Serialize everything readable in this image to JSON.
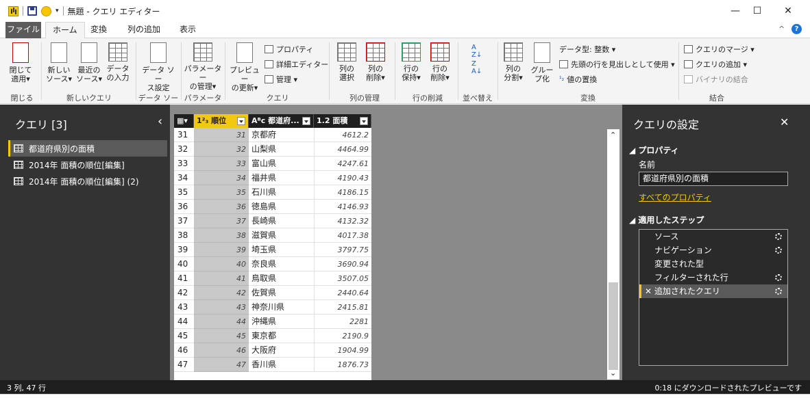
{
  "window": {
    "title": "無題 - クエリ エディター",
    "minimize": "—",
    "maximize": "☐",
    "close": "✕"
  },
  "tabs": [
    "ファイル",
    "ホーム",
    "変換",
    "列の追加",
    "表示"
  ],
  "ribbon": {
    "close_group": {
      "btn": "閉じて\n適用▾",
      "label": "閉じる"
    },
    "new_query": {
      "new_source": "新しい\nソース▾",
      "recent_source": "最近の\nソース▾",
      "enter_data": "データ\nの入力",
      "label": "新しいクエリ"
    },
    "data_source": {
      "btn": "データ ソー\nス設定",
      "label": "データ ソース"
    },
    "params": {
      "btn": "パラメーター\nの管理▾",
      "label": "パラメーター"
    },
    "query": {
      "preview": "プレビュー\nの更新▾",
      "properties": "プロパティ",
      "advanced": "詳細エディター",
      "manage": "管理 ▾",
      "label": "クエリ"
    },
    "columns": {
      "select": "列の\n選択",
      "remove": "列の\n削除▾",
      "label": "列の管理"
    },
    "rows": {
      "keep": "行の\n保持▾",
      "remove": "行の\n削除▾",
      "label": "行の削減"
    },
    "sort": {
      "label": "並べ替え"
    },
    "transform": {
      "split": "列の\n分割▾",
      "group": "グルー\nプ化",
      "datatype": "データ型: 整数 ▾",
      "header": "先頭の行を見出しとして使用 ▾",
      "replace": "値の置換",
      "label": "変換"
    },
    "combine": {
      "merge": "クエリのマージ ▾",
      "append": "クエリの追加 ▾",
      "binary": "バイナリの結合",
      "label": "結合"
    }
  },
  "left_panel": {
    "title": "クエリ [3]",
    "collapse": "‹",
    "queries": [
      "都道府県別の面積",
      "2014年 面積の順位[編集]",
      "2014年 面積の順位[編集] (2)"
    ]
  },
  "grid": {
    "headers": [
      "1²₃ 順位",
      "Aᴮc 都道府...",
      "1.2 面積"
    ],
    "rows": [
      [
        "31",
        "31",
        "京都府",
        "4612.2"
      ],
      [
        "32",
        "32",
        "山梨県",
        "4464.99"
      ],
      [
        "33",
        "33",
        "富山県",
        "4247.61"
      ],
      [
        "34",
        "34",
        "福井県",
        "4190.43"
      ],
      [
        "35",
        "35",
        "石川県",
        "4186.15"
      ],
      [
        "36",
        "36",
        "徳島県",
        "4146.93"
      ],
      [
        "37",
        "37",
        "長崎県",
        "4132.32"
      ],
      [
        "38",
        "38",
        "滋賀県",
        "4017.38"
      ],
      [
        "39",
        "39",
        "埼玉県",
        "3797.75"
      ],
      [
        "40",
        "40",
        "奈良県",
        "3690.94"
      ],
      [
        "41",
        "41",
        "鳥取県",
        "3507.05"
      ],
      [
        "42",
        "42",
        "佐賀県",
        "2440.64"
      ],
      [
        "43",
        "43",
        "神奈川県",
        "2415.81"
      ],
      [
        "44",
        "44",
        "沖縄県",
        "2281"
      ],
      [
        "45",
        "45",
        "東京都",
        "2190.9"
      ],
      [
        "46",
        "46",
        "大阪府",
        "1904.99"
      ],
      [
        "47",
        "47",
        "香川県",
        "1876.73"
      ]
    ]
  },
  "right_panel": {
    "title": "クエリの設定",
    "close": "✕",
    "properties_heading": "◢ プロパティ",
    "name_label": "名前",
    "name_value": "都道府県別の面積",
    "all_properties": "すべてのプロパティ",
    "steps_heading": "◢ 適用したステップ",
    "steps": [
      "ソース",
      "ナビゲーション",
      "変更された型",
      "フィルターされた行",
      "追加されたクエリ"
    ]
  },
  "status": {
    "left": "3 列, 47 行",
    "right": "0:18 にダウンロードされたプレビューです"
  }
}
